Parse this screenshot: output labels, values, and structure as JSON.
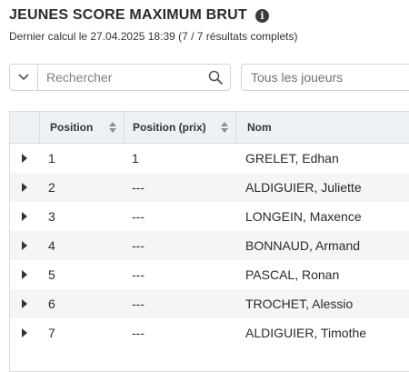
{
  "header": {
    "title": "JEUNES SCORE MAXIMUM BRUT",
    "info_icon": "i",
    "subtitle": "Dernier calcul le 27.04.2025 18:39 (7 / 7 résultats complets)"
  },
  "toolbar": {
    "search_placeholder": "Rechercher",
    "player_filter": "Tous les joueurs"
  },
  "table": {
    "columns": [
      "Position",
      "Position (prix)",
      "Nom"
    ],
    "rows": [
      {
        "position": "1",
        "prize_position": "1",
        "name": "GRELET, Edhan"
      },
      {
        "position": "2",
        "prize_position": "---",
        "name": "ALDIGUIER, Juliette"
      },
      {
        "position": "3",
        "prize_position": "---",
        "name": "LONGEIN, Maxence"
      },
      {
        "position": "4",
        "prize_position": "---",
        "name": "BONNAUD, Armand"
      },
      {
        "position": "5",
        "prize_position": "---",
        "name": "PASCAL, Ronan"
      },
      {
        "position": "6",
        "prize_position": "---",
        "name": "TROCHET, Alessio"
      },
      {
        "position": "7",
        "prize_position": "---",
        "name": "ALDIGUIER, Timothe"
      }
    ]
  }
}
